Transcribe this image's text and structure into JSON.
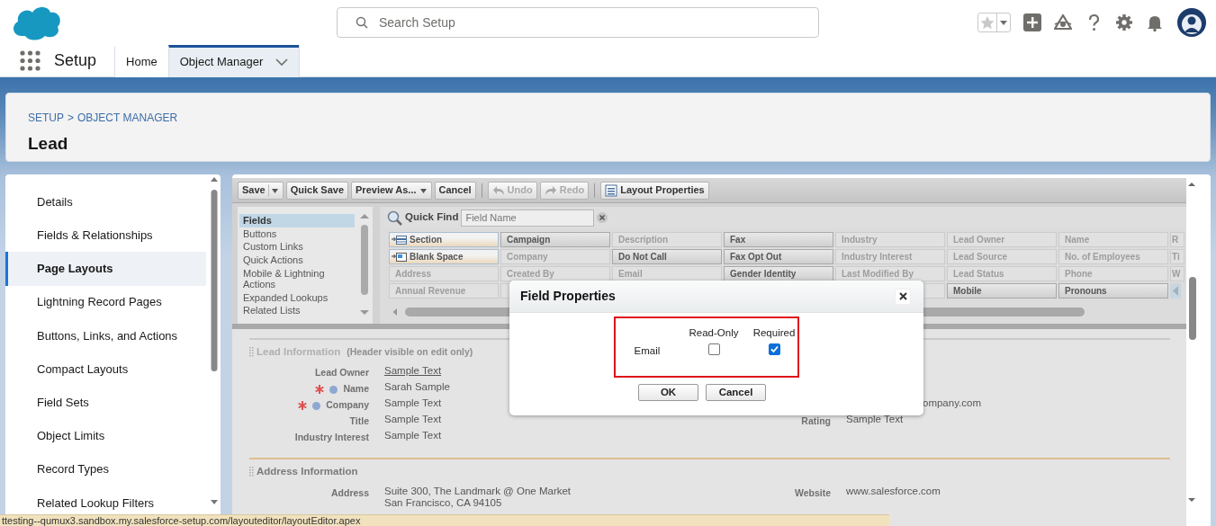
{
  "header": {
    "search": {
      "placeholder": "Search Setup"
    }
  },
  "nav": {
    "app": "Setup",
    "tabs": [
      {
        "label": "Home",
        "selected": false,
        "dropdown": false
      },
      {
        "label": "Object Manager",
        "selected": true,
        "dropdown": true
      }
    ]
  },
  "page_header": {
    "breadcrumb": {
      "items": [
        "SETUP",
        "OBJECT MANAGER"
      ],
      "separator": ">"
    },
    "title": "Lead"
  },
  "sidebar": {
    "items": [
      {
        "label": "Details",
        "selected": false
      },
      {
        "label": "Fields & Relationships",
        "selected": false
      },
      {
        "label": "Page Layouts",
        "selected": true
      },
      {
        "label": "Lightning Record Pages",
        "selected": false
      },
      {
        "label": "Buttons, Links, and Actions",
        "selected": false
      },
      {
        "label": "Compact Layouts",
        "selected": false
      },
      {
        "label": "Field Sets",
        "selected": false
      },
      {
        "label": "Object Limits",
        "selected": false
      },
      {
        "label": "Record Types",
        "selected": false
      },
      {
        "label": "Related Lookup Filters",
        "selected": false
      }
    ]
  },
  "editor": {
    "toolbar": [
      {
        "label": "Save",
        "kind": "split",
        "disabled": false
      },
      {
        "label": "Quick Save",
        "kind": "button",
        "disabled": false
      },
      {
        "label": "Preview As...",
        "kind": "menu",
        "disabled": false
      },
      {
        "label": "Cancel",
        "kind": "button",
        "disabled": false
      },
      {
        "kind": "separator"
      },
      {
        "label": "Undo",
        "kind": "undo",
        "disabled": true
      },
      {
        "label": "Redo",
        "kind": "redo",
        "disabled": true
      },
      {
        "kind": "separator"
      },
      {
        "label": "Layout Properties",
        "kind": "properties",
        "disabled": false
      }
    ],
    "categories": [
      {
        "label": "Fields",
        "selected": true
      },
      {
        "label": "Buttons",
        "selected": false
      },
      {
        "label": "Custom Links",
        "selected": false
      },
      {
        "label": "Quick Actions",
        "selected": false
      },
      {
        "label": "Mobile & Lightning Actions",
        "selected": false
      },
      {
        "label": "Expanded Lookups",
        "selected": false
      },
      {
        "label": "Related Lists",
        "selected": false
      }
    ],
    "quick_find": {
      "label": "Quick Find",
      "placeholder": "Field Name"
    },
    "tiles": [
      [
        {
          "label": "Section",
          "kind": "section"
        },
        {
          "label": "Campaign",
          "kind": "field",
          "in_layout": false
        },
        {
          "label": "Description",
          "kind": "field",
          "in_layout": true
        },
        {
          "label": "Fax",
          "kind": "field",
          "in_layout": false
        },
        {
          "label": "Industry",
          "kind": "field",
          "in_layout": true
        },
        {
          "label": "Lead Owner",
          "kind": "field",
          "in_layout": true
        },
        {
          "label": "Name",
          "kind": "field",
          "in_layout": true
        },
        {
          "label": "R",
          "kind": "field",
          "in_layout": true
        }
      ],
      [
        {
          "label": "Blank Space",
          "kind": "blank"
        },
        {
          "label": "Company",
          "kind": "field",
          "in_layout": true
        },
        {
          "label": "Do Not Call",
          "kind": "field",
          "in_layout": false
        },
        {
          "label": "Fax Opt Out",
          "kind": "field",
          "in_layout": false
        },
        {
          "label": "Industry Interest",
          "kind": "field",
          "in_layout": true
        },
        {
          "label": "Lead Source",
          "kind": "field",
          "in_layout": true
        },
        {
          "label": "No. of Employees",
          "kind": "field",
          "in_layout": true
        },
        {
          "label": "Ti",
          "kind": "field",
          "in_layout": true
        }
      ],
      [
        {
          "label": "Address",
          "kind": "field",
          "in_layout": true
        },
        {
          "label": "Created By",
          "kind": "field",
          "in_layout": true
        },
        {
          "label": "Email",
          "kind": "field",
          "in_layout": true
        },
        {
          "label": "Gender Identity",
          "kind": "field",
          "in_layout": false
        },
        {
          "label": "Last Modified By",
          "kind": "field",
          "in_layout": true
        },
        {
          "label": "Lead Status",
          "kind": "field",
          "in_layout": true
        },
        {
          "label": "Phone",
          "kind": "field",
          "in_layout": true
        },
        {
          "label": "W",
          "kind": "field",
          "in_layout": true
        }
      ],
      [
        {
          "label": "Annual Revenue",
          "kind": "field",
          "in_layout": true
        },
        {
          "kind": "covered"
        },
        {
          "kind": "hidden"
        },
        {
          "kind": "hidden"
        },
        {
          "kind": "covered"
        },
        {
          "label": "Mobile",
          "kind": "field",
          "in_layout": false
        },
        {
          "label": "Pronouns",
          "kind": "field",
          "in_layout": false
        },
        {
          "kind": "arrow"
        }
      ]
    ],
    "sections": [
      {
        "title": "Lead Information",
        "note": "(Header visible on edit only)",
        "faded": true,
        "highlighted": false,
        "rows": [
          {
            "left": {
              "label": "Lead Owner",
              "value": "Sample Text",
              "link": true,
              "required": false,
              "always_on_layout": false
            }
          },
          {
            "left": {
              "label": "Name",
              "value": "Sarah Sample",
              "link": false,
              "required": true,
              "always_on_layout": true
            }
          },
          {
            "left": {
              "label": "Company",
              "value": "Sample Text",
              "link": false,
              "required": true,
              "always_on_layout": true
            },
            "right": {
              "value": "ompany.com",
              "link": false,
              "required": false,
              "always_on_layout": false
            }
          },
          {
            "left": {
              "label": "Title",
              "value": "Sample Text",
              "link": false,
              "required": false,
              "always_on_layout": false
            },
            "right": {
              "label": "Rating",
              "value": "Sample Text",
              "link": false,
              "required": false,
              "always_on_layout": false
            }
          },
          {
            "left": {
              "label": "Industry Interest",
              "value": "Sample Text",
              "link": false,
              "required": false,
              "always_on_layout": false
            }
          }
        ]
      },
      {
        "title": "Address Information",
        "faded": false,
        "highlighted": true,
        "rows": [
          {
            "left": {
              "label": "Address",
              "lines": [
                "Suite 300, The Landmark @ One Market",
                "San Francisco, CA 94105"
              ],
              "link": false,
              "required": false,
              "always_on_layout": false
            },
            "right": {
              "label": "Website",
              "value": "www.salesforce.com",
              "link": false,
              "required": false,
              "always_on_layout": false
            }
          }
        ]
      }
    ]
  },
  "dialog": {
    "title": "Field Properties",
    "columns": [
      "Read-Only",
      "Required"
    ],
    "field": {
      "label": "Email",
      "read_only": false,
      "required": true
    },
    "buttons": [
      "OK",
      "Cancel"
    ]
  },
  "status_bar": {
    "url": "ttesting--qumux3.sandbox.my.salesforce-setup.com/layouteditor/layoutEditor.apex"
  }
}
